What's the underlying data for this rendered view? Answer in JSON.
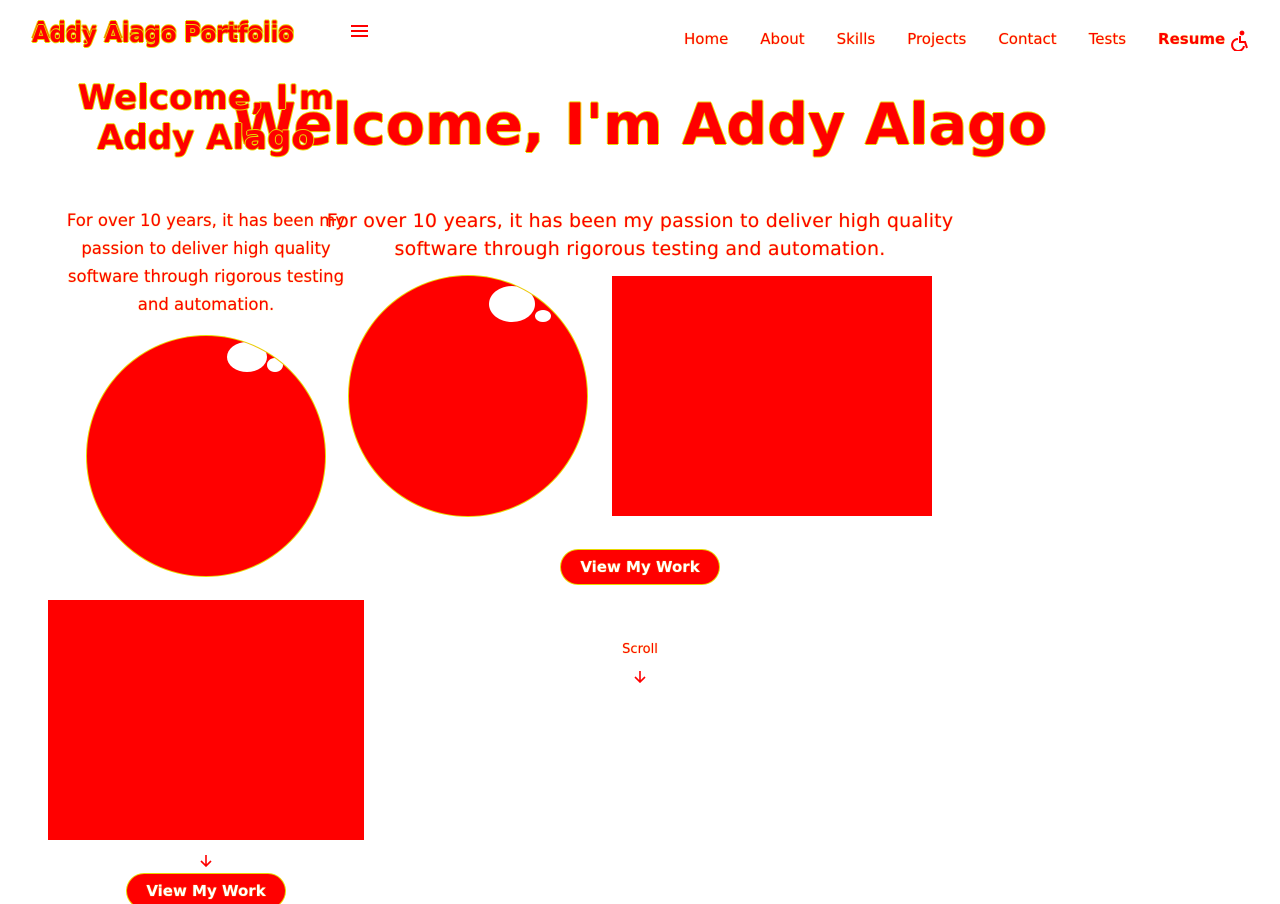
{
  "header": {
    "brand": "Addy Alago Portfolio",
    "menu_icon": "hamburger-menu-icon",
    "nav": [
      {
        "label": "Home"
      },
      {
        "label": "About"
      },
      {
        "label": "Skills"
      },
      {
        "label": "Projects"
      },
      {
        "label": "Contact"
      },
      {
        "label": "Tests"
      },
      {
        "label": "Resume"
      }
    ],
    "accessibility_icon": "accessibility-icon"
  },
  "hero": {
    "title": "Welcome, I'm Addy Alago",
    "mobile_title_line1": "Welcome, I'm",
    "mobile_title_line2": "Addy Alago",
    "subtitle": "For over 10 years, it has been my passion to deliver high quality software through rigorous testing and automation.",
    "cta_label": "View My Work",
    "scroll_label": "Scroll",
    "scroll_icon": "arrow-down-icon"
  },
  "colors": {
    "primary": "#ff0000",
    "outline": "#e8d800",
    "background": "#ffffff"
  }
}
